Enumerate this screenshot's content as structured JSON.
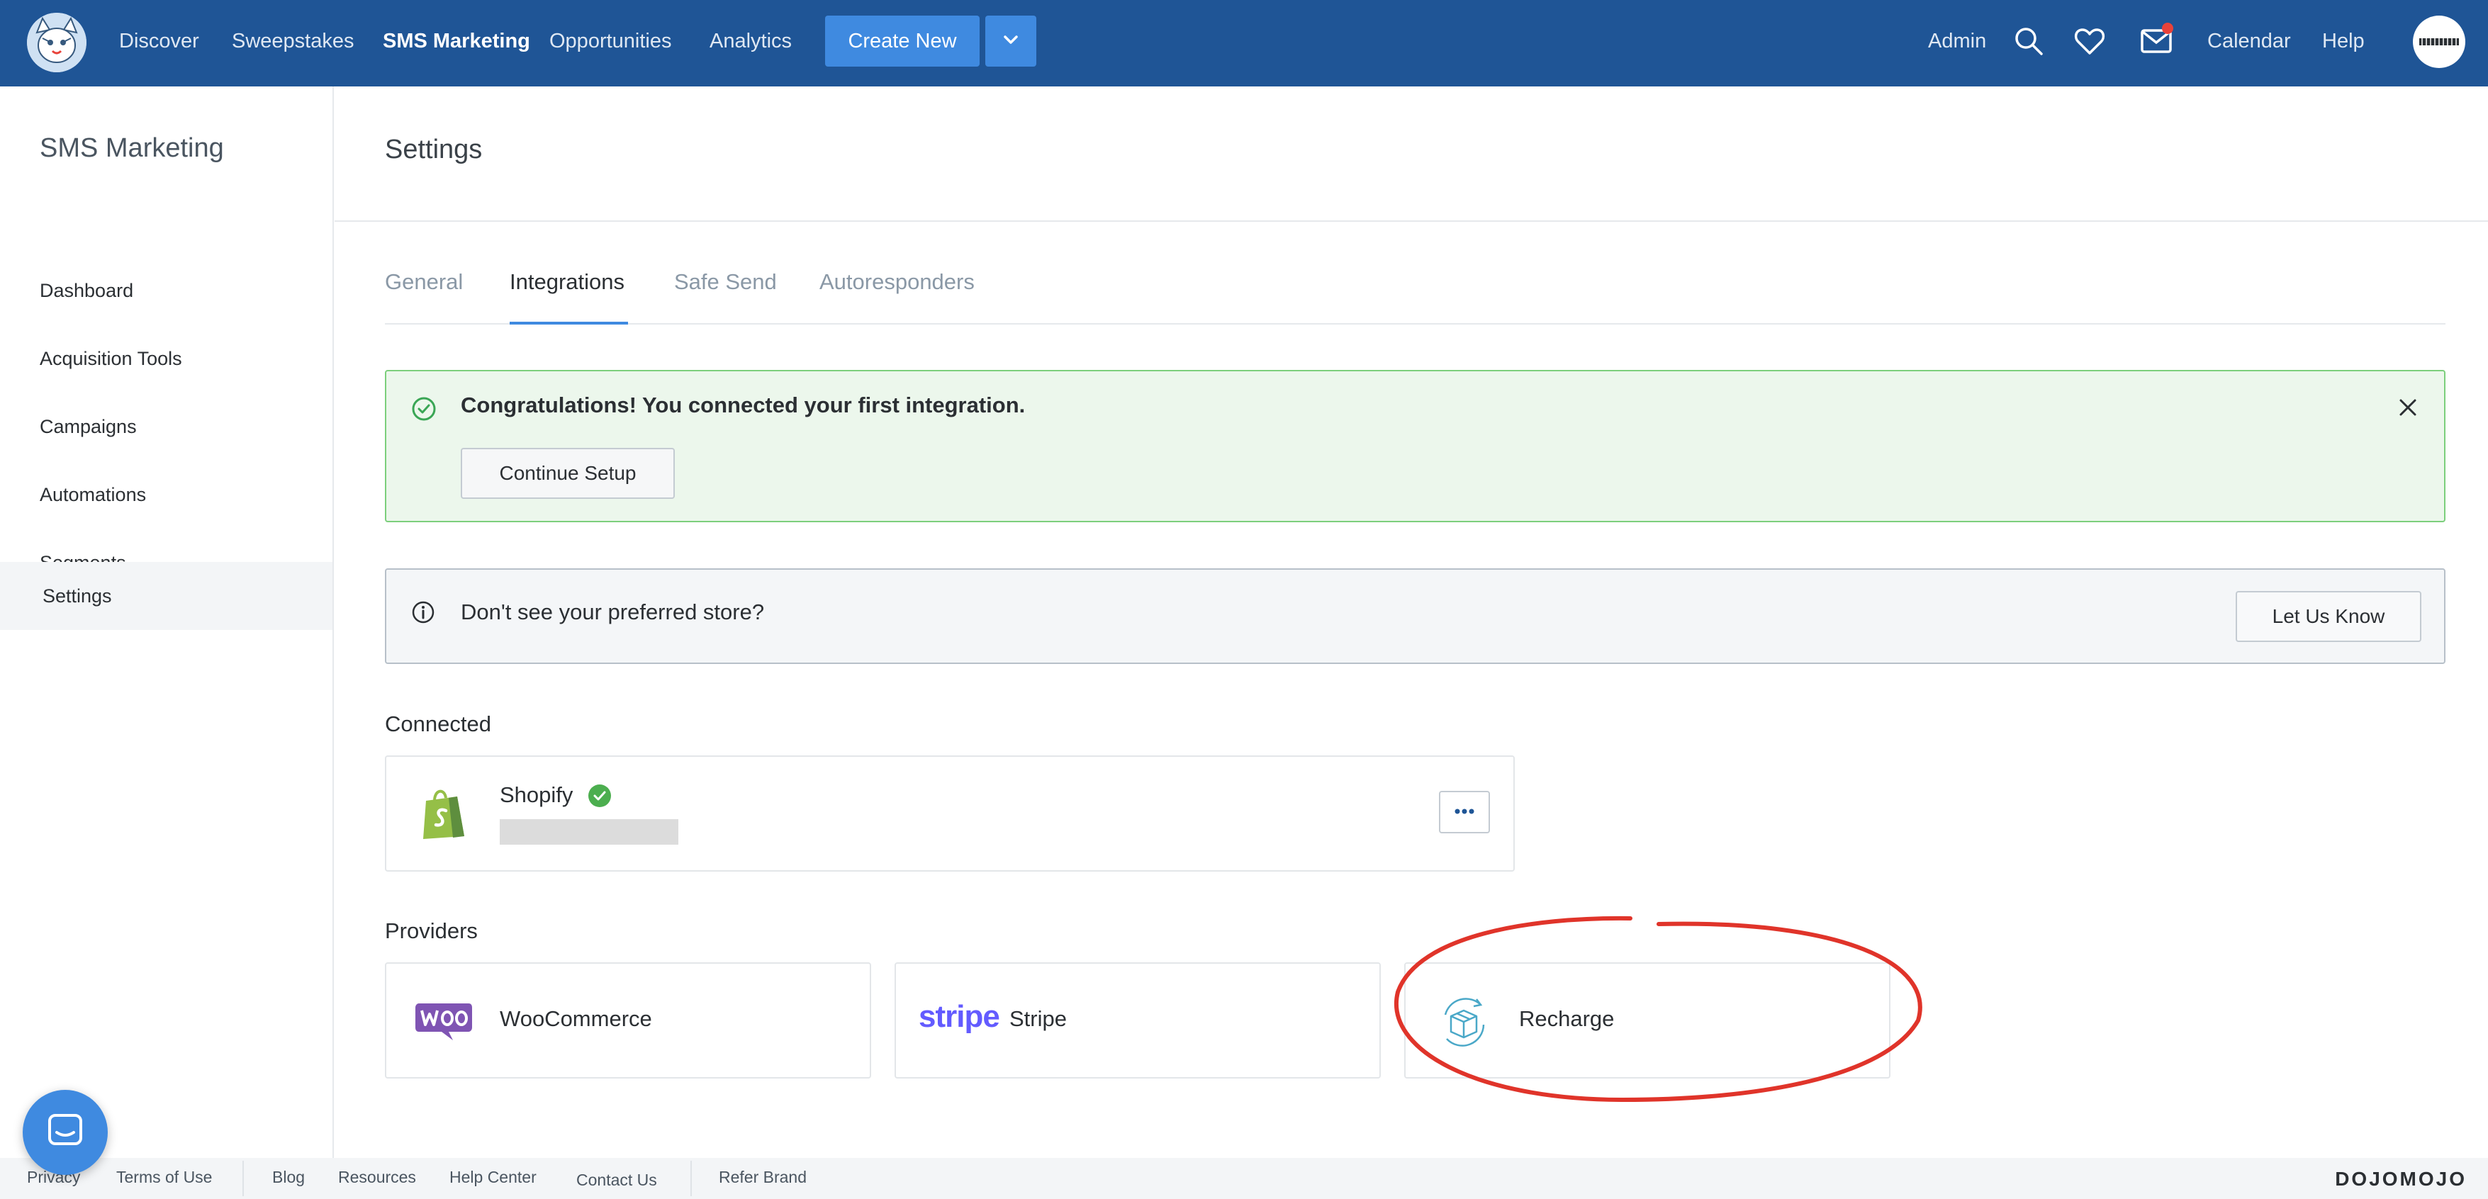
{
  "nav": {
    "links": [
      "Discover",
      "Sweepstakes",
      "SMS Marketing",
      "Opportunities",
      "Analytics"
    ],
    "create_label": "Create New",
    "admin_label": "Admin",
    "calendar_label": "Calendar",
    "help_label": "Help",
    "avatar_text": "ꟷꟷꟷ"
  },
  "sidebar": {
    "title": "SMS Marketing",
    "items": [
      "Dashboard",
      "Acquisition Tools",
      "Campaigns",
      "Automations",
      "Segments",
      "Settings"
    ],
    "active_index": 5
  },
  "page": {
    "title": "Settings",
    "tabs": [
      "General",
      "Integrations",
      "Safe Send",
      "Autoresponders"
    ],
    "active_tab": 1
  },
  "success_alert": {
    "message": "Congratulations! You connected your first integration.",
    "button_label": "Continue Setup"
  },
  "info_alert": {
    "message": "Don't see your preferred store?",
    "button_label": "Let Us Know"
  },
  "connected": {
    "label": "Connected",
    "items": [
      {
        "name": "Shopify",
        "status": "connected"
      }
    ]
  },
  "providers": {
    "label": "Providers",
    "items": [
      {
        "name": "WooCommerce",
        "logo_text": "Woo"
      },
      {
        "name": "Stripe",
        "logo_text": "stripe"
      },
      {
        "name": "Recharge",
        "logo_text": ""
      }
    ]
  },
  "footer": {
    "links": [
      "Privacy",
      "Terms of Use",
      "Blog",
      "Resources",
      "Help Center",
      "Contact Us",
      "Refer Brand"
    ],
    "brand": "DOJOMOJO"
  },
  "colors": {
    "nav_bg": "#1f5596",
    "accent": "#3f8ae0",
    "success_border": "#7ccf7c",
    "annotation": "#e0342a"
  }
}
